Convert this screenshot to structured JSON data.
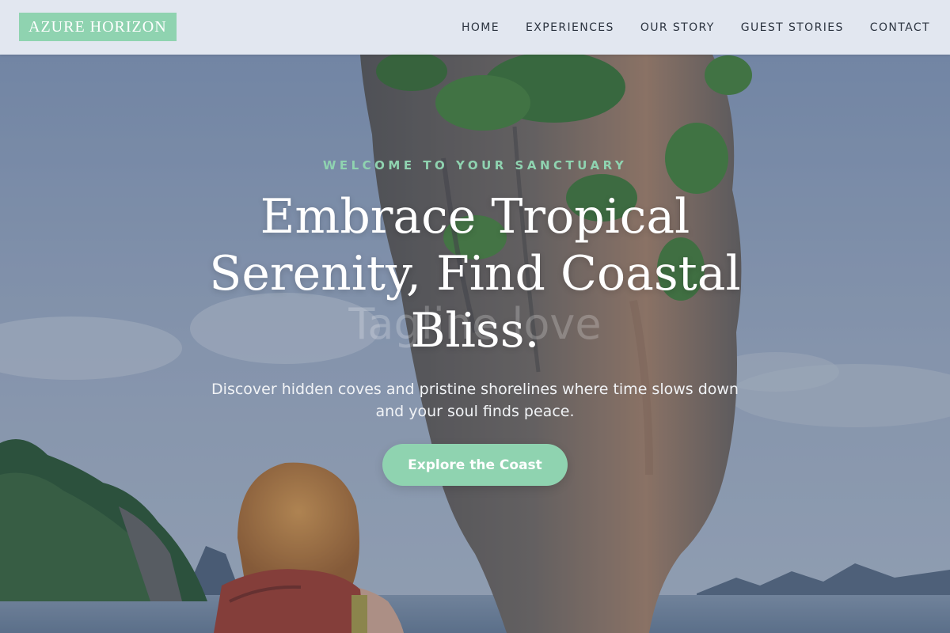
{
  "header": {
    "logo_text": "AZURE HORIZON",
    "nav": [
      {
        "label": "HOME"
      },
      {
        "label": "EXPERIENCES"
      },
      {
        "label": "OUR STORY"
      },
      {
        "label": "GUEST STORIES"
      },
      {
        "label": "CONTACT"
      }
    ]
  },
  "hero": {
    "eyebrow": "WELCOME TO YOUR SANCTUARY",
    "headline": "Embrace Tropical Serenity, Find Coastal Bliss.",
    "subheadline": "Discover hidden coves and pristine shorelines where time slows down and your soul finds peace.",
    "cta_label": "Explore the Coast",
    "background_ghost_text": "Tagline love"
  },
  "colors": {
    "accent": "#8fd3b0",
    "header_bg": "#e7ebf2",
    "nav_text": "#2c3440",
    "overlay": "#283a5a"
  }
}
